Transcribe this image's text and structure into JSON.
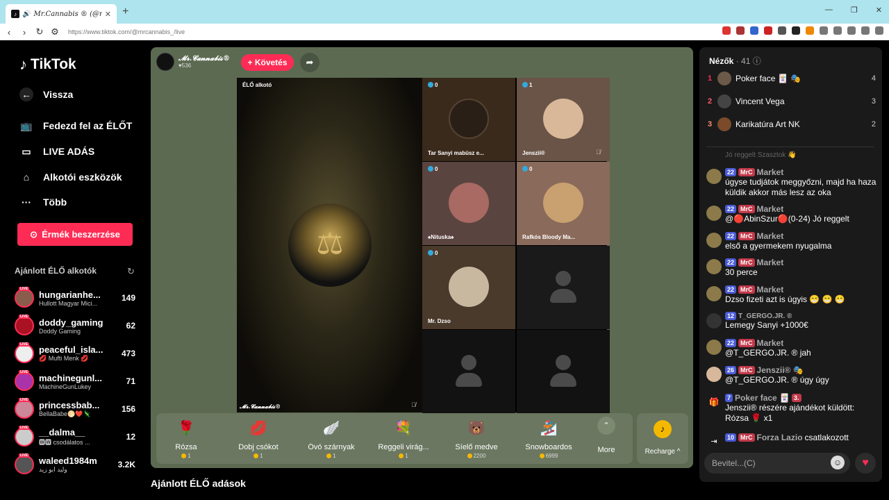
{
  "browser": {
    "tab_title": "Mr.Cannabis ® (@mrcannabis",
    "url": "https://www.tiktok.com/@mrcannabis_/live"
  },
  "sidebar": {
    "logo": "TikTok",
    "back": "Vissza",
    "items": [
      "Fedezd fel az ÉLŐT",
      "LIVE ADÁS",
      "Alkotói eszközök",
      "Több"
    ],
    "coins_button": "Érmék beszerzése",
    "recommended_heading": "Ajánlott ÉLŐ alkotók",
    "recommended": [
      {
        "name": "hungarianhe...",
        "sub": "Hullott Magyar Mici...",
        "count": "149"
      },
      {
        "name": "doddy_gaming",
        "sub": "Doddy Gaming",
        "count": "62"
      },
      {
        "name": "peaceful_isla...",
        "sub": "💋 Mufti Menk 💋",
        "count": "473"
      },
      {
        "name": "machinegunl...",
        "sub": "MachineGunLukey",
        "count": "71"
      },
      {
        "name": "princessbab...",
        "sub": "BellaBabe🌕❤️🦎",
        "count": "156"
      },
      {
        "name": "__dalma__",
        "sub": "🆆🆆 csodálatos ...",
        "count": "12"
      },
      {
        "name": "waleed1984m",
        "sub": "وليد ابو زيد",
        "count": "3.2K"
      }
    ],
    "live_badge": "LIVE"
  },
  "host": {
    "name": "𝓜𝓻.𝓒𝓪𝓷𝓷𝓪𝓫𝓲𝓼®",
    "likes": "♥536",
    "follow": "+ Követés",
    "elo_label": "ÉLŐ alkotó",
    "footer": "𝓜𝓻.𝓒𝓪𝓷𝓷𝓪𝓫𝓲𝓼®"
  },
  "guests": [
    {
      "count": "0",
      "label": "Tar Sanyi mabüsz e..."
    },
    {
      "count": "1",
      "label": "Jenszii®"
    },
    {
      "count": "0",
      "label": "♠Nituska♠"
    },
    {
      "count": "0",
      "label": "Rafkós Bloody Ma..."
    },
    {
      "count": "0",
      "label": "Mr. Dzso"
    }
  ],
  "gifts": [
    {
      "name": "Rózsa",
      "price": "1",
      "icon": "🌹"
    },
    {
      "name": "Dobj csókot",
      "price": "1",
      "icon": "💋"
    },
    {
      "name": "Óvó szárnyak",
      "price": "1",
      "icon": "🪽"
    },
    {
      "name": "Reggeli virág...",
      "price": "1",
      "icon": "💐"
    },
    {
      "name": "Síelő medve",
      "price": "2200",
      "icon": "🐻"
    },
    {
      "name": "Snowboardos",
      "price": "6999",
      "icon": "🏂"
    }
  ],
  "more_label": "More",
  "recharge_label": "Recharge ^",
  "below_heading": "Ajánlott ÉLŐ adások",
  "viewers": {
    "title": "Nézők",
    "count": "· 41",
    "top": [
      {
        "rank": "1",
        "name": "Poker face 🃏 🎭",
        "score": "4"
      },
      {
        "rank": "2",
        "name": "Vincent Vega",
        "score": "3"
      },
      {
        "rank": "3",
        "name": "Karikatúra Art NK",
        "score": "2"
      }
    ]
  },
  "chat": [
    {
      "level": "22",
      "fan": "MrC",
      "user": "Market",
      "text": "úgyse tudjátok meggyőzni, majd ha haza küldik akkor más lesz az oka"
    },
    {
      "level": "22",
      "fan": "MrC",
      "user": "Market",
      "text": "@🔴AbinSzur🔴(0-24) Jó reggelt"
    },
    {
      "level": "22",
      "fan": "MrC",
      "user": "Market",
      "text": "első a gyermekem nyugalma"
    },
    {
      "level": "22",
      "fan": "MrC",
      "user": "Market",
      "text": "30 perce"
    },
    {
      "level": "22",
      "fan": "MrC",
      "user": "Market",
      "text": "Dzso fizeti azt is úgyis 😁 😁 😁"
    },
    {
      "level": "12",
      "fan": "",
      "user": "T_GERGO.JR. ®",
      "text": "Lemegy Sanyi +1000€"
    },
    {
      "level": "22",
      "fan": "MrC",
      "user": "Market",
      "text": "@T_GERGO.JR. ® jah"
    },
    {
      "level": "26",
      "fan": "MrC",
      "user": "Jenszii® 🎭",
      "text": "@T_GERGO.JR. ® úgy úgy"
    },
    {
      "level": "7",
      "fan": "3.",
      "user": "Poker face 🃏",
      "text": "Jenszii® részére ajándékot küldött: Rózsa 🌹 x1"
    },
    {
      "level": "10",
      "fan": "MrC",
      "user": "Forza Lazio",
      "text": "csatlakozott"
    }
  ],
  "chat_faded": "Jó reggelt Szasztok 👋",
  "input_placeholder": "Bevitel...(C)"
}
